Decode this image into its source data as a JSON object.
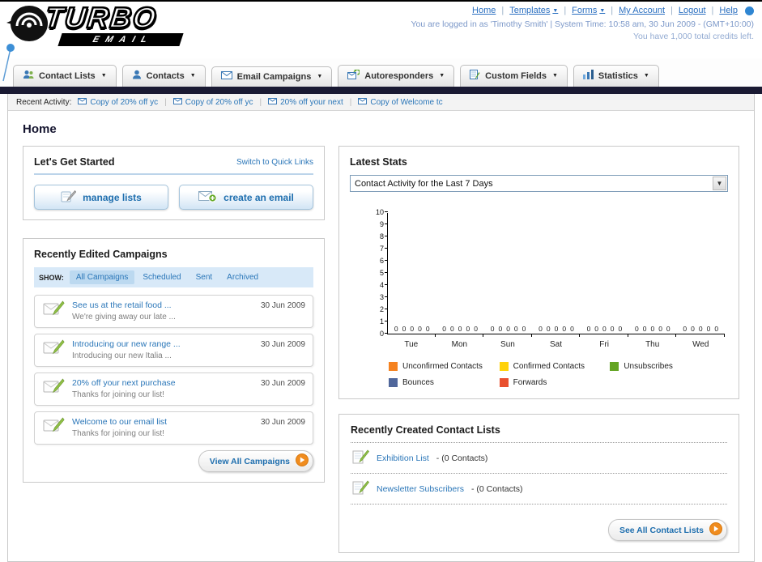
{
  "header": {
    "nav": [
      "Home",
      "Templates",
      "Forms",
      "My Account",
      "Logout",
      "Help"
    ],
    "status": "You are logged in as 'Timothy Smith' | System Time: 10:58 am, 30 Jun 2009 - (GMT+10:00)",
    "credits": "You have 1,000 total credits left."
  },
  "logo": {
    "title": "TURBO",
    "subtitle": "EMAIL"
  },
  "main_nav": {
    "items": [
      {
        "label": "Contact Lists"
      },
      {
        "label": "Contacts"
      },
      {
        "label": "Email Campaigns"
      },
      {
        "label": "Autoresponders"
      },
      {
        "label": "Custom Fields"
      },
      {
        "label": "Statistics"
      }
    ]
  },
  "activity": {
    "label": "Recent Activity:",
    "items": [
      "Copy of 20% off yc",
      "Copy of 20% off yc",
      "20% off your next",
      "Copy of Welcome tc"
    ]
  },
  "page": {
    "title": "Home"
  },
  "get_started": {
    "title": "Let's Get Started",
    "switch_link": "Switch to Quick Links",
    "buttons": [
      {
        "label": "manage lists"
      },
      {
        "label": "create an email"
      }
    ]
  },
  "campaigns": {
    "title": "Recently Edited Campaigns",
    "show_label": "SHOW:",
    "tabs": [
      "All Campaigns",
      "Scheduled",
      "Sent",
      "Archived"
    ],
    "active_tab": "All Campaigns",
    "items": [
      {
        "title": "See us at the retail food ...",
        "subtitle": "We're giving away our late ...",
        "date": "30 Jun 2009"
      },
      {
        "title": "Introducing our new range ...",
        "subtitle": "Introducing our new Italia ...",
        "date": "30 Jun 2009"
      },
      {
        "title": "20% off your next purchase",
        "subtitle": "Thanks for joining our list!",
        "date": "30 Jun 2009"
      },
      {
        "title": "Welcome to our email list",
        "subtitle": "Thanks for joining our list!",
        "date": "30 Jun 2009"
      }
    ],
    "view_all_label": "View All Campaigns"
  },
  "stats": {
    "title": "Latest Stats",
    "dropdown_value": "Contact Activity for the Last 7 Days"
  },
  "chart_data": {
    "type": "bar",
    "title": "Contact Activity for the Last 7 Days",
    "categories": [
      "Tue",
      "Mon",
      "Sun",
      "Sat",
      "Fri",
      "Thu",
      "Wed"
    ],
    "series": [
      {
        "name": "Unconfirmed Contacts",
        "color": "#f58220",
        "values": [
          0,
          0,
          0,
          0,
          0,
          0,
          0
        ]
      },
      {
        "name": "Confirmed Contacts",
        "color": "#ffd20a",
        "values": [
          0,
          0,
          0,
          0,
          0,
          0,
          0
        ]
      },
      {
        "name": "Unsubscribes",
        "color": "#63a422",
        "values": [
          0,
          0,
          0,
          0,
          0,
          0,
          0
        ]
      },
      {
        "name": "Bounces",
        "color": "#50679b",
        "values": [
          0,
          0,
          0,
          0,
          0,
          0,
          0
        ]
      },
      {
        "name": "Forwards",
        "color": "#e9502e",
        "values": [
          0,
          0,
          0,
          0,
          0,
          0,
          0
        ]
      }
    ],
    "ylim": [
      0,
      10
    ],
    "yticks": [
      0,
      1,
      2,
      3,
      4,
      5,
      6,
      7,
      8,
      9,
      10
    ],
    "grid": false,
    "legend_position": "bottom"
  },
  "contact_lists": {
    "title": "Recently Created Contact Lists",
    "items": [
      {
        "name": "Exhibition List",
        "suffix": " - (0 Contacts)"
      },
      {
        "name": "Newsletter Subscribers",
        "suffix": " - (0 Contacts)"
      }
    ],
    "see_all_label": "See All Contact Lists"
  }
}
